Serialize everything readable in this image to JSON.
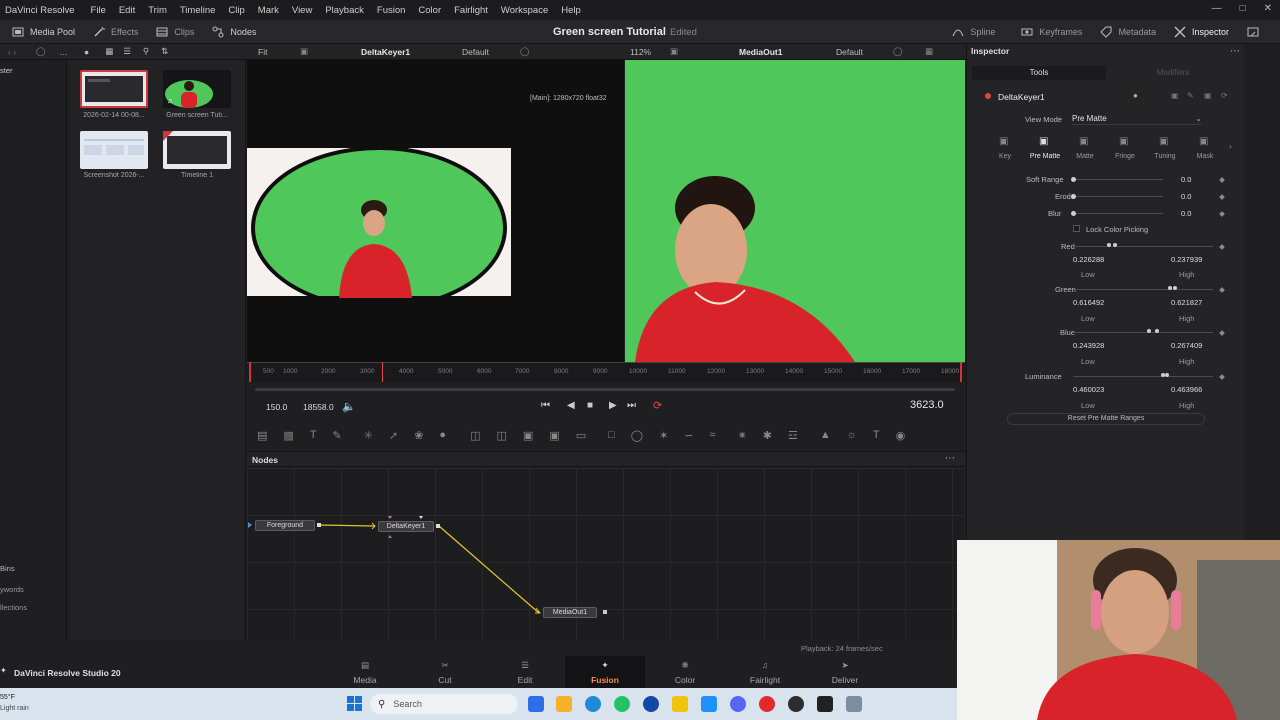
{
  "menubar": {
    "items": [
      "DaVinci Resolve",
      "File",
      "Edit",
      "Trim",
      "Timeline",
      "Clip",
      "Mark",
      "View",
      "Playback",
      "Fusion",
      "Color",
      "Fairlight",
      "Workspace",
      "Help"
    ]
  },
  "toolbar": {
    "media_pool": "Media Pool",
    "effects": "Effects",
    "clips": "Clips",
    "nodes": "Nodes",
    "spline": "Spline",
    "keyframes": "Keyframes",
    "metadata": "Metadata",
    "inspector": "Inspector"
  },
  "project": {
    "title": "Green screen Tutorial",
    "status": "Edited"
  },
  "viewer_left_header": {
    "fit": "Fit",
    "node": "DeltaKeyer1",
    "preset": "Default"
  },
  "viewer_right_header": {
    "zoom": "112%",
    "node": "MediaOut1",
    "preset": "Default"
  },
  "viewer_left": {
    "info": "[Main]: 1280x720 float32"
  },
  "media_pool": {
    "side_label": "ster",
    "bins": [
      "Bins",
      "ywords",
      "llections"
    ],
    "clips": [
      {
        "label": "2026-02-14 00-08..."
      },
      {
        "label": "Green screen Tuti..."
      },
      {
        "label": "Screenshot 2026-..."
      },
      {
        "label": "Timeline 1"
      }
    ]
  },
  "ruler": {
    "ticks": [
      "500",
      "1000",
      "2000",
      "3000",
      "4000",
      "5000",
      "6000",
      "7000",
      "8000",
      "9000",
      "10000",
      "11000",
      "12000",
      "13000",
      "14000",
      "15000",
      "16000",
      "17000",
      "18000"
    ]
  },
  "transport": {
    "start": "150.0",
    "end": "18558.0",
    "current": "3623.0"
  },
  "nodes_panel": {
    "title": "Nodes",
    "nodes": {
      "foreground": "Foreground",
      "keyer": "DeltaKeyer1",
      "out": "MediaOut1"
    }
  },
  "inspector": {
    "title": "Inspector",
    "tabs": {
      "tools": "Tools",
      "modifiers": "Modifiers"
    },
    "tool_name": "DeltaKeyer1",
    "view_mode_label": "View Mode",
    "view_mode_value": "Pre Matte",
    "subtabs": [
      "Key",
      "Pre Matte",
      "Matte",
      "Fringe",
      "Tuning",
      "Mask"
    ],
    "sliders": [
      {
        "label": "Soft Range",
        "value": "0.0"
      },
      {
        "label": "Erode",
        "value": "0.0"
      },
      {
        "label": "Blur",
        "value": "0.0"
      }
    ],
    "lock_color_picking": "Lock Color Picking",
    "ranges": [
      {
        "label": "Red",
        "low": "0.226288",
        "high": "0.237939"
      },
      {
        "label": "Green",
        "low": "0.616492",
        "high": "0.621827"
      },
      {
        "label": "Blue",
        "low": "0.243928",
        "high": "0.267409"
      },
      {
        "label": "Luminance",
        "low": "0.460023",
        "high": "0.463966"
      }
    ],
    "low_label": "Low",
    "high_label": "High",
    "reset_button": "Reset Pre Matte Ranges"
  },
  "status": {
    "playback": "Playback: 24 frames/sec"
  },
  "brand": "DaVinci Resolve Studio 20",
  "pages": [
    "Media",
    "Cut",
    "Edit",
    "Fusion",
    "Color",
    "Fairlight",
    "Deliver"
  ],
  "active_page": "Fusion",
  "taskbar": {
    "search": "Search",
    "weather_temp": "55°F",
    "weather_desc": "Light rain"
  },
  "colors": {
    "accent": "#ff8a3c",
    "green_screen": "#4fc75a",
    "hoodie": "#d8232a",
    "node_link": "#e2c52a"
  }
}
